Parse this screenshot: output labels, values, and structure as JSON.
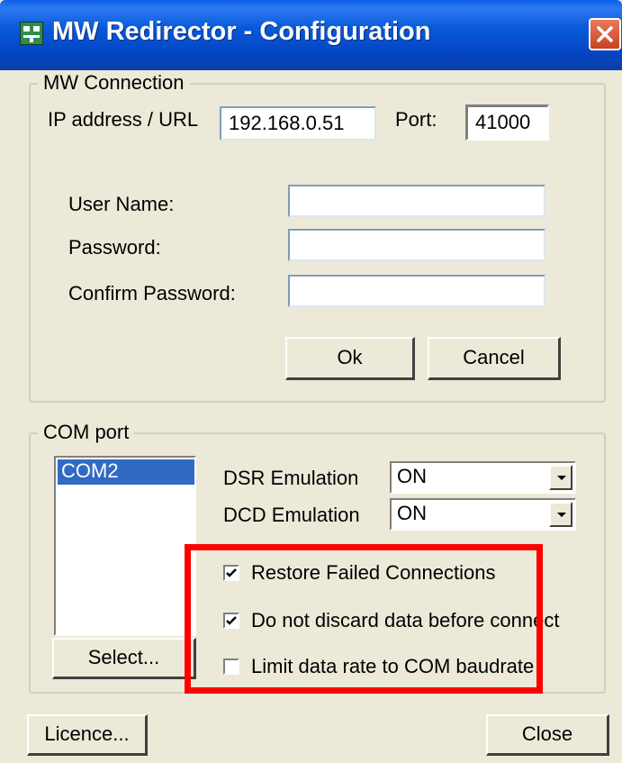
{
  "window": {
    "title": "MW Redirector - Configuration",
    "icon": "app-icon",
    "close_icon": "close-icon"
  },
  "mw_connection": {
    "group_label": "MW Connection",
    "ip_label": "IP address / URL",
    "ip_value": "192.168.0.51",
    "port_label": "Port:",
    "port_value": "41000",
    "username_label": "User Name:",
    "username_value": "",
    "password_label": "Password:",
    "password_value": "",
    "confirm_label": "Confirm Password:",
    "confirm_value": "",
    "ok_label": "Ok",
    "cancel_label": "Cancel"
  },
  "com_port": {
    "group_label": "COM port",
    "list_items": [
      "COM2"
    ],
    "selected_item": "COM2",
    "dsr_label": "DSR Emulation",
    "dsr_value": "ON",
    "dcd_label": "DCD Emulation",
    "dcd_value": "ON",
    "select_label": "Select...",
    "checkboxes": [
      {
        "label": "Restore Failed Connections",
        "checked": true
      },
      {
        "label": "Do not discard data before connect",
        "checked": true
      },
      {
        "label": "Limit data rate to COM baudrate",
        "checked": false
      }
    ]
  },
  "footer": {
    "licence_label": "Licence...",
    "close_label": "Close"
  },
  "colors": {
    "title_bar": "#0A5FE8",
    "dialog_bg": "#ECE9D8",
    "selection": "#316AC5",
    "highlight_box": "#FF0000",
    "close_button": "#D9532E"
  }
}
